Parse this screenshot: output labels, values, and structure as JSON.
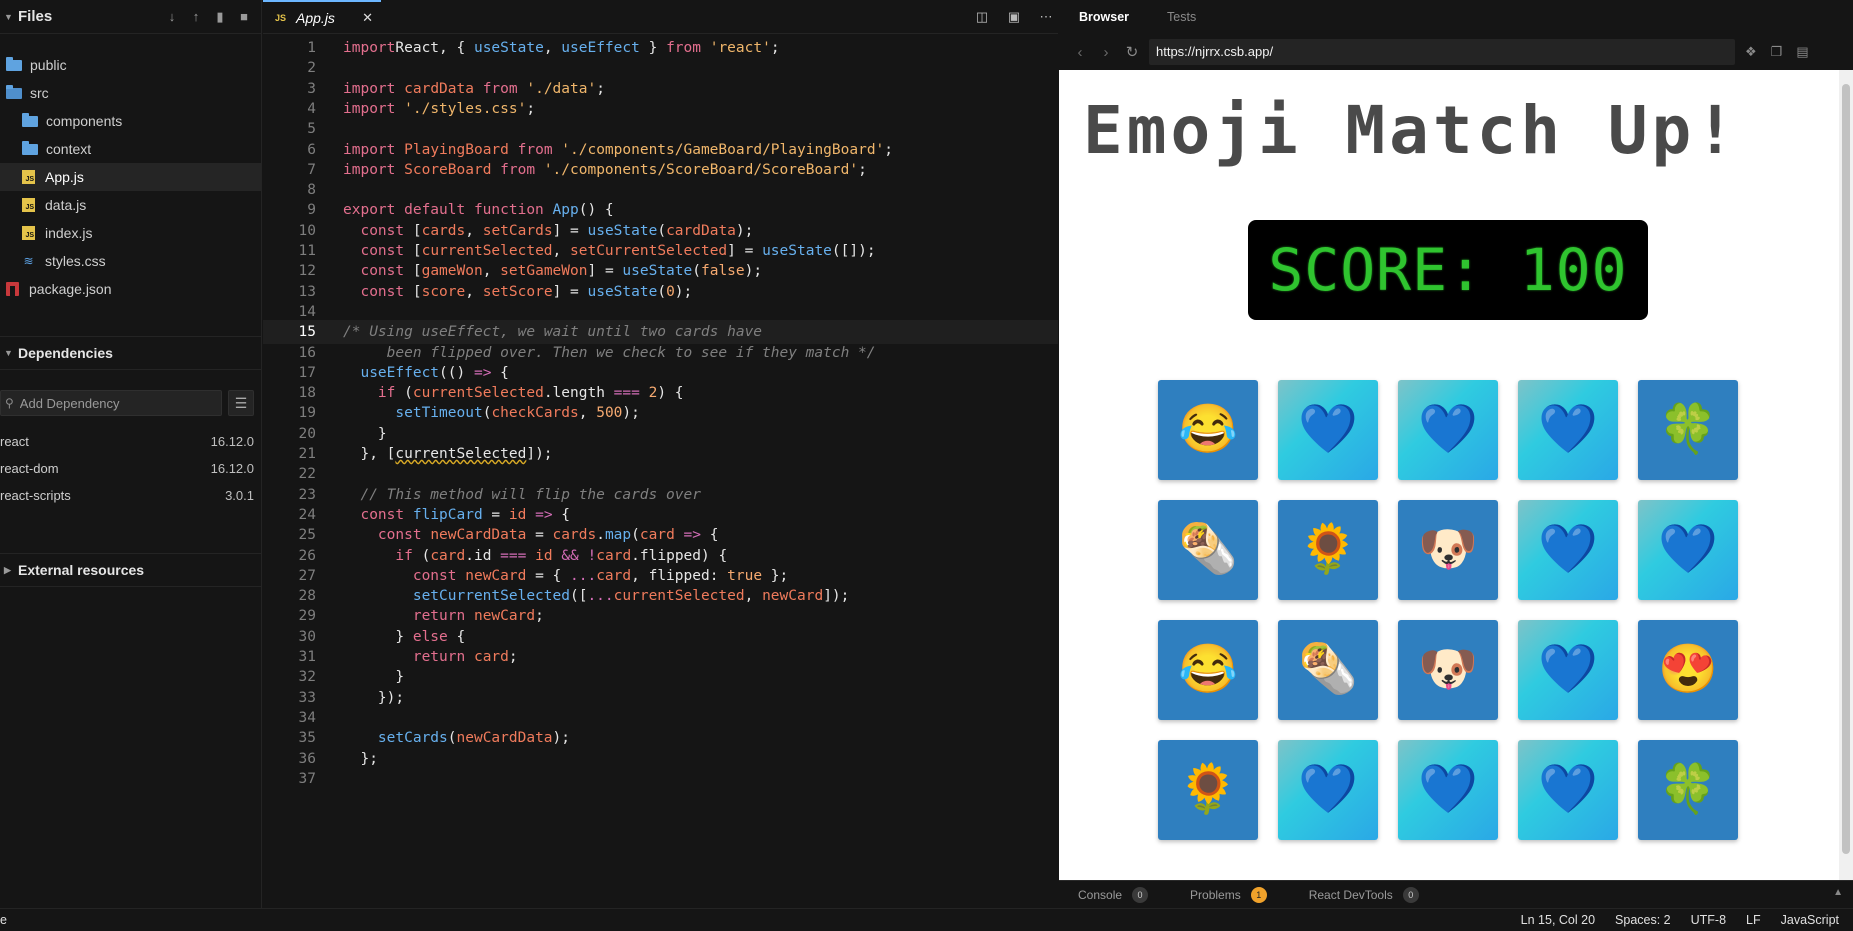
{
  "sidebar": {
    "title": "Files",
    "tree": [
      {
        "name": "public",
        "kind": "folder",
        "depth": 0
      },
      {
        "name": "src",
        "kind": "folder-open",
        "depth": 0
      },
      {
        "name": "components",
        "kind": "folder",
        "depth": 1
      },
      {
        "name": "context",
        "kind": "folder",
        "depth": 1
      },
      {
        "name": "App.js",
        "kind": "js",
        "depth": 1,
        "active": true
      },
      {
        "name": "data.js",
        "kind": "js",
        "depth": 1
      },
      {
        "name": "index.js",
        "kind": "js",
        "depth": 1
      },
      {
        "name": "styles.css",
        "kind": "css",
        "depth": 1
      },
      {
        "name": "package.json",
        "kind": "pkg",
        "depth": 0
      }
    ],
    "dependencies_title": "Dependencies",
    "add_dependency_placeholder": "Add Dependency",
    "dependencies": [
      {
        "name": "react",
        "version": "16.12.0"
      },
      {
        "name": "react-dom",
        "version": "16.12.0"
      },
      {
        "name": "react-scripts",
        "version": "3.0.1"
      }
    ],
    "external_title": "External resources"
  },
  "editor": {
    "tab_label": "App.js",
    "tab_badge": "JS",
    "current_line": 15,
    "lines": [
      [
        [
          "kw",
          "import"
        ],
        [
          "",
          "React, { "
        ],
        [
          "fn",
          "useState"
        ],
        [
          "",
          ", "
        ],
        [
          "fn",
          "useEffect"
        ],
        [
          "",
          " } "
        ],
        [
          "kw",
          "from"
        ],
        [
          "",
          " "
        ],
        [
          "str",
          "'react'"
        ],
        [
          "",
          ";"
        ]
      ],
      [],
      [
        [
          "kw",
          "import"
        ],
        [
          "",
          " "
        ],
        [
          "var",
          "cardData"
        ],
        [
          "",
          " "
        ],
        [
          "kw",
          "from"
        ],
        [
          "",
          " "
        ],
        [
          "str",
          "'./data'"
        ],
        [
          "",
          ";"
        ]
      ],
      [
        [
          "kw",
          "import"
        ],
        [
          "",
          " "
        ],
        [
          "str",
          "'./styles.css'"
        ],
        [
          "",
          ";"
        ]
      ],
      [],
      [
        [
          "kw",
          "import"
        ],
        [
          "",
          " "
        ],
        [
          "var",
          "PlayingBoard"
        ],
        [
          "",
          " "
        ],
        [
          "kw",
          "from"
        ],
        [
          "",
          " "
        ],
        [
          "str",
          "'./components/GameBoard/PlayingBoard'"
        ],
        [
          "",
          ";"
        ]
      ],
      [
        [
          "kw",
          "import"
        ],
        [
          "",
          " "
        ],
        [
          "var",
          "ScoreBoard"
        ],
        [
          "",
          " "
        ],
        [
          "kw",
          "from"
        ],
        [
          "",
          " "
        ],
        [
          "str",
          "'./components/ScoreBoard/ScoreBoard'"
        ],
        [
          "",
          ";"
        ]
      ],
      [],
      [
        [
          "kw",
          "export default function"
        ],
        [
          "",
          " "
        ],
        [
          "fn",
          "App"
        ],
        [
          "",
          "() {"
        ]
      ],
      [
        [
          "",
          "  "
        ],
        [
          "kw",
          "const"
        ],
        [
          "",
          " ["
        ],
        [
          "var",
          "cards"
        ],
        [
          "",
          ", "
        ],
        [
          "var",
          "setCards"
        ],
        [
          "",
          "] = "
        ],
        [
          "fn",
          "useState"
        ],
        [
          "",
          "("
        ],
        [
          "var",
          "cardData"
        ],
        [
          "",
          ");"
        ]
      ],
      [
        [
          "",
          "  "
        ],
        [
          "kw",
          "const"
        ],
        [
          "",
          " ["
        ],
        [
          "var",
          "currentSelected"
        ],
        [
          "",
          ", "
        ],
        [
          "var",
          "setCurrentSelected"
        ],
        [
          "",
          "] = "
        ],
        [
          "fn",
          "useState"
        ],
        [
          "",
          "([]);"
        ]
      ],
      [
        [
          "",
          "  "
        ],
        [
          "kw",
          "const"
        ],
        [
          "",
          " ["
        ],
        [
          "var",
          "gameWon"
        ],
        [
          "",
          ", "
        ],
        [
          "var",
          "setGameWon"
        ],
        [
          "",
          "] = "
        ],
        [
          "fn",
          "useState"
        ],
        [
          "",
          "("
        ],
        [
          "num",
          "false"
        ],
        [
          "",
          ");"
        ]
      ],
      [
        [
          "",
          "  "
        ],
        [
          "kw",
          "const"
        ],
        [
          "",
          " ["
        ],
        [
          "var",
          "score"
        ],
        [
          "",
          ", "
        ],
        [
          "var",
          "setScore"
        ],
        [
          "",
          "] = "
        ],
        [
          "fn",
          "useState"
        ],
        [
          "",
          "("
        ],
        [
          "num",
          "0"
        ],
        [
          "",
          ");"
        ]
      ],
      [],
      [
        [
          "cm",
          "/* Using useEffect, we wait until two cards have"
        ]
      ],
      [
        [
          "cm",
          "     been flipped over. Then we check to see if they match */"
        ]
      ],
      [
        [
          "",
          "  "
        ],
        [
          "fn",
          "useEffect"
        ],
        [
          "",
          "(() "
        ],
        [
          "op",
          "=>"
        ],
        [
          "",
          " {"
        ]
      ],
      [
        [
          "",
          "    "
        ],
        [
          "kw",
          "if"
        ],
        [
          "",
          " ("
        ],
        [
          "var",
          "currentSelected"
        ],
        [
          "",
          ".length "
        ],
        [
          "op",
          "==="
        ],
        [
          "",
          " "
        ],
        [
          "num",
          "2"
        ],
        [
          "",
          ") {"
        ]
      ],
      [
        [
          "",
          "      "
        ],
        [
          "fn",
          "setTimeout"
        ],
        [
          "",
          "("
        ],
        [
          "var",
          "checkCards"
        ],
        [
          "",
          ", "
        ],
        [
          "num",
          "500"
        ],
        [
          "",
          ");"
        ]
      ],
      [
        [
          "",
          "    }"
        ]
      ],
      [
        [
          "",
          "  }, ["
        ],
        [
          "sq",
          "currentSelected"
        ],
        [
          "",
          "]);"
        ]
      ],
      [],
      [
        [
          "cm",
          "  // This method will flip the cards over"
        ]
      ],
      [
        [
          "",
          "  "
        ],
        [
          "kw",
          "const"
        ],
        [
          "",
          " "
        ],
        [
          "fn",
          "flipCard"
        ],
        [
          "",
          " = "
        ],
        [
          "var",
          "id"
        ],
        [
          "",
          " "
        ],
        [
          "op",
          "=>"
        ],
        [
          "",
          " {"
        ]
      ],
      [
        [
          "",
          "    "
        ],
        [
          "kw",
          "const"
        ],
        [
          "",
          " "
        ],
        [
          "var",
          "newCardData"
        ],
        [
          "",
          " = "
        ],
        [
          "var",
          "cards"
        ],
        [
          "",
          "."
        ],
        [
          "fn",
          "map"
        ],
        [
          "",
          "("
        ],
        [
          "var",
          "card"
        ],
        [
          "",
          " "
        ],
        [
          "op",
          "=>"
        ],
        [
          "",
          " {"
        ]
      ],
      [
        [
          "",
          "      "
        ],
        [
          "kw",
          "if"
        ],
        [
          "",
          " ("
        ],
        [
          "var",
          "card"
        ],
        [
          "",
          ".id "
        ],
        [
          "op",
          "==="
        ],
        [
          "",
          " "
        ],
        [
          "var",
          "id"
        ],
        [
          "",
          " "
        ],
        [
          "op",
          "&&"
        ],
        [
          "",
          " "
        ],
        [
          "op",
          "!"
        ],
        [
          "var",
          "card"
        ],
        [
          "",
          ".flipped) {"
        ]
      ],
      [
        [
          "",
          "        "
        ],
        [
          "kw",
          "const"
        ],
        [
          "",
          " "
        ],
        [
          "var",
          "newCard"
        ],
        [
          "",
          " = { "
        ],
        [
          "op",
          "..."
        ],
        [
          "var",
          "card"
        ],
        [
          "",
          ", flipped: "
        ],
        [
          "num",
          "true"
        ],
        [
          "",
          " };"
        ]
      ],
      [
        [
          "",
          "        "
        ],
        [
          "fn",
          "setCurrentSelected"
        ],
        [
          "",
          "(["
        ],
        [
          "op",
          "..."
        ],
        [
          "var",
          "currentSelected"
        ],
        [
          "",
          ", "
        ],
        [
          "var",
          "newCard"
        ],
        [
          "",
          "]);"
        ]
      ],
      [
        [
          "",
          "        "
        ],
        [
          "kw",
          "return"
        ],
        [
          "",
          " "
        ],
        [
          "var",
          "newCard"
        ],
        [
          "",
          ";"
        ]
      ],
      [
        [
          "",
          "      } "
        ],
        [
          "kw",
          "else"
        ],
        [
          "",
          " {"
        ]
      ],
      [
        [
          "",
          "        "
        ],
        [
          "kw",
          "return"
        ],
        [
          "",
          " "
        ],
        [
          "var",
          "card"
        ],
        [
          "",
          ";"
        ]
      ],
      [
        [
          "",
          "      }"
        ]
      ],
      [
        [
          "",
          "    });"
        ]
      ],
      [],
      [
        [
          "",
          "    "
        ],
        [
          "fn",
          "setCards"
        ],
        [
          "",
          "("
        ],
        [
          "var",
          "newCardData"
        ],
        [
          "",
          ");"
        ]
      ],
      [
        [
          "",
          "  };"
        ]
      ],
      [
        [
          "",
          "37"
        ]
      ]
    ]
  },
  "browser": {
    "tabs": [
      "Browser",
      "Tests"
    ],
    "url": "https://njrrx.csb.app/",
    "game_title": "Emoji Match Up!",
    "score_text": "SCORE: 100",
    "cards": [
      {
        "state": "up",
        "emoji": "😂"
      },
      {
        "state": "down",
        "emoji": "💙"
      },
      {
        "state": "down",
        "emoji": "💙"
      },
      {
        "state": "down",
        "emoji": "💙"
      },
      {
        "state": "up",
        "emoji": "🍀"
      },
      {
        "state": "up",
        "emoji": "🌯"
      },
      {
        "state": "up",
        "emoji": "🌻"
      },
      {
        "state": "up",
        "emoji": "🐶"
      },
      {
        "state": "down",
        "emoji": "💙"
      },
      {
        "state": "down",
        "emoji": "💙"
      },
      {
        "state": "up",
        "emoji": "😂"
      },
      {
        "state": "up",
        "emoji": "🌯"
      },
      {
        "state": "up",
        "emoji": "🐶"
      },
      {
        "state": "down",
        "emoji": "💙"
      },
      {
        "state": "up",
        "emoji": "😍"
      },
      {
        "state": "up",
        "emoji": "🌻"
      },
      {
        "state": "down",
        "emoji": "💙"
      },
      {
        "state": "down",
        "emoji": "💙"
      },
      {
        "state": "down",
        "emoji": "💙"
      },
      {
        "state": "up",
        "emoji": "🍀"
      }
    ],
    "bottom_tabs": [
      {
        "label": "Console",
        "count": "0"
      },
      {
        "label": "Problems",
        "count": "1"
      },
      {
        "label": "React DevTools",
        "count": "0"
      }
    ]
  },
  "status": {
    "left": "e",
    "position": "Ln 15, Col 20",
    "spaces": "Spaces: 2",
    "encoding": "UTF-8",
    "eol": "LF",
    "language": "JavaScript"
  },
  "colors": {
    "accent": "#6cb6ff",
    "score_green": "#2fc42f",
    "card_face": "#2f7fbf"
  }
}
